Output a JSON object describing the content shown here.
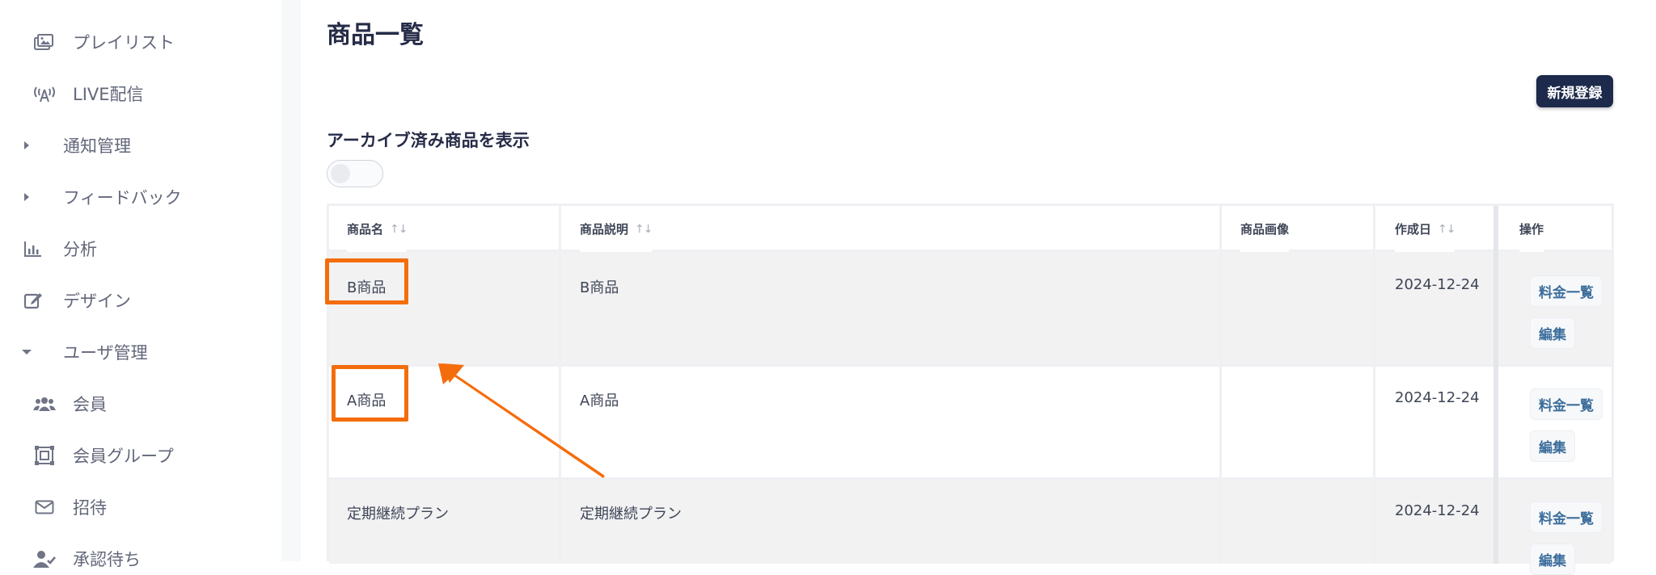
{
  "sidebar": {
    "items": [
      {
        "label": "プレイリスト",
        "icon": "playlist-icon"
      },
      {
        "label": "LIVE配信",
        "icon": "broadcast-icon"
      },
      {
        "label": "通知管理",
        "icon": "caret-right-icon"
      },
      {
        "label": "フィードバック",
        "icon": "caret-right-icon"
      },
      {
        "label": "分析",
        "icon": "chart-icon"
      },
      {
        "label": "デザイン",
        "icon": "edit-icon"
      },
      {
        "label": "ユーザ管理",
        "icon": "caret-down-icon"
      },
      {
        "label": "会員",
        "icon": "users-icon"
      },
      {
        "label": "会員グループ",
        "icon": "group-icon"
      },
      {
        "label": "招待",
        "icon": "envelope-icon"
      },
      {
        "label": "承認待ち",
        "icon": "user-check-icon"
      }
    ]
  },
  "main": {
    "title": "商品一覧",
    "new_button": "新規登録",
    "archive_label": "アーカイブ済み商品を表示",
    "archive_toggle_on": false
  },
  "table": {
    "headers": {
      "name": "商品名",
      "description": "商品説明",
      "image": "商品画像",
      "created": "作成日",
      "actions": "操作"
    },
    "sort_glyph": "↑↓",
    "rows": [
      {
        "name": "B商品",
        "description": "B商品",
        "created": "2024-12-24",
        "action1": "料金一覧",
        "action2": "編集"
      },
      {
        "name": "A商品",
        "description": "A商品",
        "created": "2024-12-24",
        "action1": "料金一覧",
        "action2": "編集"
      },
      {
        "name": "定期継続プラン",
        "description": "定期継続プラン",
        "created": "2024-12-24",
        "action1": "料金一覧",
        "action2": "編集"
      }
    ]
  },
  "colors": {
    "highlight": "#f46d0d",
    "primary_button": "#1d2a4b",
    "link": "#3c6e9c"
  }
}
